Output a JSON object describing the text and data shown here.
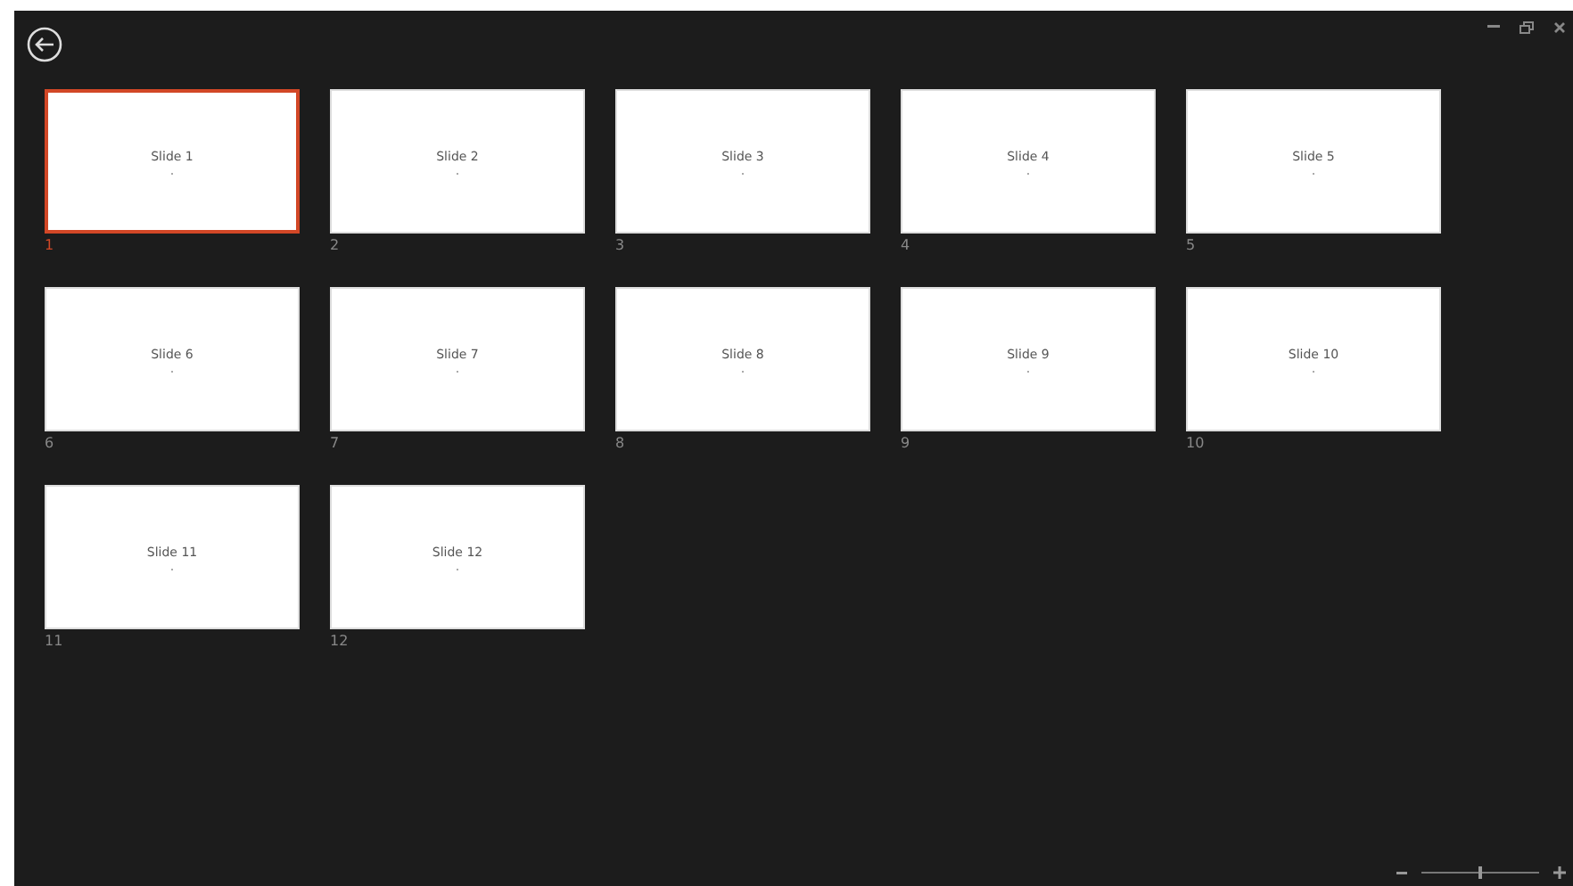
{
  "slides": [
    {
      "title": "Slide 1",
      "number": "1",
      "selected": true
    },
    {
      "title": "Slide 2",
      "number": "2",
      "selected": false
    },
    {
      "title": "Slide 3",
      "number": "3",
      "selected": false
    },
    {
      "title": "Slide 4",
      "number": "4",
      "selected": false
    },
    {
      "title": "Slide 5",
      "number": "5",
      "selected": false
    },
    {
      "title": "Slide 6",
      "number": "6",
      "selected": false
    },
    {
      "title": "Slide 7",
      "number": "7",
      "selected": false
    },
    {
      "title": "Slide 8",
      "number": "8",
      "selected": false
    },
    {
      "title": "Slide 9",
      "number": "9",
      "selected": false
    },
    {
      "title": "Slide 10",
      "number": "10",
      "selected": false
    },
    {
      "title": "Slide 11",
      "number": "11",
      "selected": false
    },
    {
      "title": "Slide 12",
      "number": "12",
      "selected": false
    }
  ],
  "zoom": {
    "level": 0.5
  }
}
